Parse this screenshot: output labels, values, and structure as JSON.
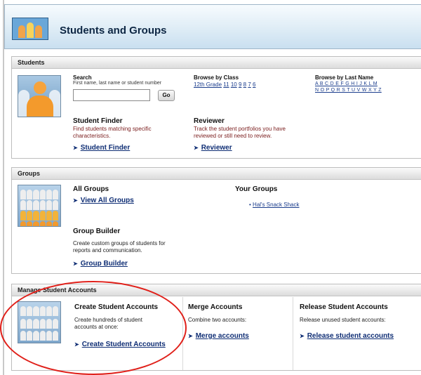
{
  "header": {
    "title": "Students and Groups",
    "icon": "students-groups-icon"
  },
  "students": {
    "heading": "Students",
    "search": {
      "label": "Search",
      "hint": "First name, last name or student number",
      "value": "",
      "go_label": "Go"
    },
    "browse_class": {
      "label": "Browse by Class",
      "items": [
        "12th Grade",
        "11",
        "10",
        "9",
        "8",
        "7",
        "6"
      ]
    },
    "browse_last_name": {
      "label": "Browse by Last Name",
      "row1": "A B C D E F G H I J  K L M",
      "row2": "N O P Q R S T U V W X Y Z"
    },
    "finder": {
      "title": "Student Finder",
      "desc": "Find students matching specific characteristics.",
      "link": "Student Finder"
    },
    "reviewer": {
      "title": "Reviewer",
      "desc": "Track the student portfolios you have reviewed or still need to review.",
      "link": "Reviewer"
    }
  },
  "groups": {
    "heading": "Groups",
    "all_groups": {
      "title": "All Groups",
      "link": "View All Groups"
    },
    "your_groups": {
      "title": "Your Groups",
      "items": [
        "Hal's Snack Shack"
      ]
    },
    "builder": {
      "title": "Group Builder",
      "desc": "Create custom groups of students for reports and communication.",
      "link": "Group Builder"
    }
  },
  "manage": {
    "heading": "Manage Student Accounts",
    "create": {
      "title": "Create Student Accounts",
      "desc": "Create hundreds of student accounts at once:",
      "link": "Create Student Accounts"
    },
    "merge": {
      "title": "Merge Accounts",
      "desc": "Combine two accounts:",
      "link": "Merge accounts"
    },
    "release": {
      "title": "Release Student Accounts",
      "desc": "Release unused student accounts:",
      "link": "Release student accounts"
    }
  },
  "colors": {
    "annotation": "#e0201a",
    "link": "#1a3c8c",
    "header_bg": "#dcebf5"
  }
}
